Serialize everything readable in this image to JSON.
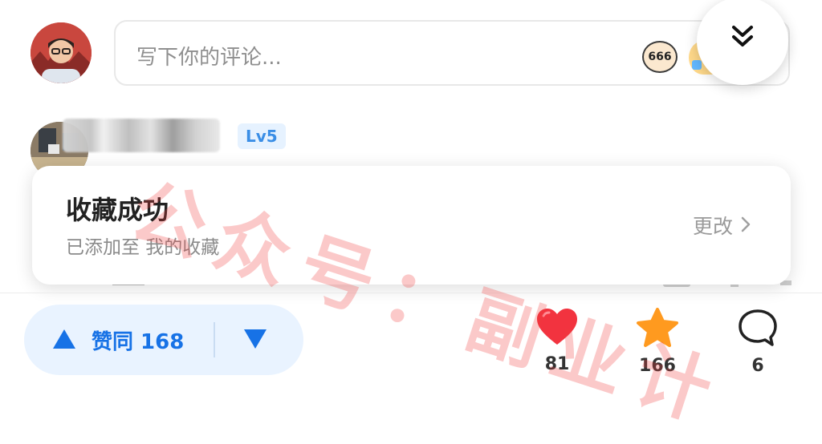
{
  "comment_input": {
    "placeholder": "写下你的评论..."
  },
  "emojis": [
    {
      "name": "emoji-666-icon",
      "text": "666"
    },
    {
      "name": "emoji-sticker-icon",
      "text": ""
    }
  ],
  "comment": {
    "level_badge": "Lv5"
  },
  "toast": {
    "title": "收藏成功",
    "subtitle": "已添加至 我的收藏",
    "change_label": "更改"
  },
  "bottom_bar": {
    "upvote_label": "赞同 168",
    "like_count": "81",
    "favorite_count": "166",
    "comment_count": "6"
  },
  "colors": {
    "accent_blue": "#1772e6",
    "heart_red": "#f2333f",
    "star_orange": "#ff9a1f",
    "pill_bg": "#e9f3ff",
    "watermark_red": "#f03c3c"
  },
  "watermark": {
    "text": "公众号：副业计"
  }
}
